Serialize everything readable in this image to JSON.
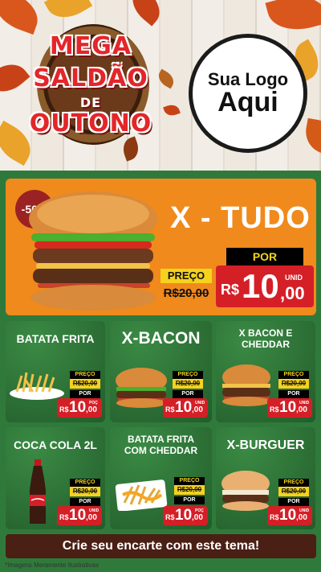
{
  "hero": {
    "badge_line1": "MEGA",
    "badge_line2": "SALDÃO",
    "badge_line3": "DE",
    "badge_line4": "OUTONO",
    "logo_line1": "Sua Logo",
    "logo_line2": "Aqui"
  },
  "featured": {
    "discount": "-50%",
    "title": "X - TUDO",
    "preco_label": "PREÇO",
    "old_price": "R$20,00",
    "por_label": "POR",
    "currency": "R$",
    "price_int": "10",
    "price_dec": ",00",
    "unit": "UNID"
  },
  "products": [
    {
      "title": "BATATA FRITA",
      "preco_label": "PREÇO",
      "old_price": "R$20,00",
      "por_label": "POR",
      "currency": "R$",
      "price_int": "10",
      "price_dec": ",00",
      "unit": "POÇ"
    },
    {
      "title": "X-BACON",
      "preco_label": "PREÇO",
      "old_price": "R$20,00",
      "por_label": "POR",
      "currency": "R$",
      "price_int": "10",
      "price_dec": ",00",
      "unit": "UNID"
    },
    {
      "title_line1": "X BACON E",
      "title_line2": "CHEDDAR",
      "preco_label": "PREÇO",
      "old_price": "R$20,00",
      "por_label": "POR",
      "currency": "R$",
      "price_int": "10",
      "price_dec": ",00",
      "unit": "UNID"
    },
    {
      "title": "COCA COLA 2L",
      "preco_label": "PREÇO",
      "old_price": "R$20,00",
      "por_label": "POR",
      "currency": "R$",
      "price_int": "10",
      "price_dec": ",00",
      "unit": "UNID"
    },
    {
      "title_line1": "BATATA FRITA",
      "title_line2": "COM CHEDDAR",
      "preco_label": "PREÇO",
      "old_price": "R$20,00",
      "por_label": "POR",
      "currency": "R$",
      "price_int": "10",
      "price_dec": ",00",
      "unit": "POÇ"
    },
    {
      "title": "X-BURGUER",
      "preco_label": "PREÇO",
      "old_price": "R$20,00",
      "por_label": "POR",
      "currency": "R$",
      "price_int": "10",
      "price_dec": ",00",
      "unit": "UNID"
    }
  ],
  "footer": {
    "cta": "Crie seu encarte com este tema!",
    "note": "*Imagens Meramente Ilustrativas"
  },
  "colors": {
    "accent_red": "#e3262a",
    "price_red": "#d41f27",
    "yellow": "#f5d21e",
    "green": "#2f7a3b",
    "orange": "#f08a1c"
  }
}
